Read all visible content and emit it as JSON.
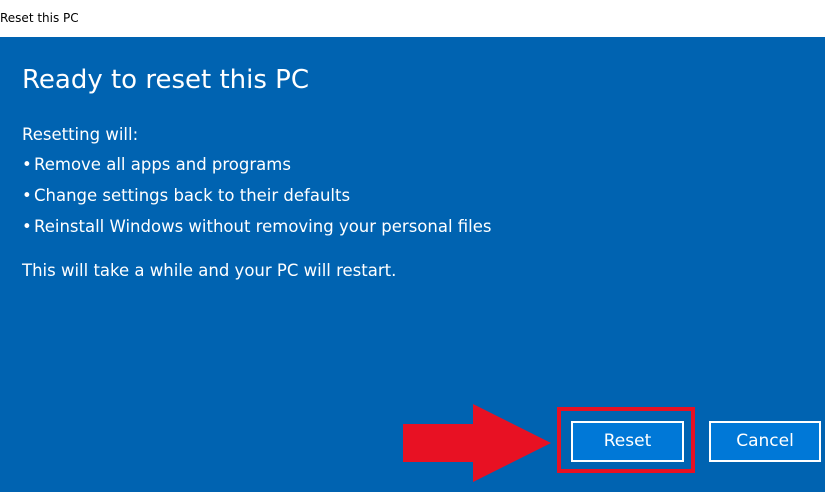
{
  "window": {
    "title": "Reset this PC"
  },
  "dialog": {
    "heading": "Ready to reset this PC",
    "intro": "Resetting will:",
    "bullets": [
      "Remove all apps and programs",
      "Change settings back to their defaults",
      "Reinstall Windows without removing your personal files"
    ],
    "note": "This will take a while and your PC will restart."
  },
  "buttons": {
    "reset_label": "Reset",
    "cancel_label": "Cancel"
  },
  "annotations": {
    "arrow_color": "#e81123",
    "highlight_color": "#e81123"
  },
  "colors": {
    "panel_background": "#0063b1",
    "button_background": "#0078d7",
    "text": "#ffffff"
  }
}
